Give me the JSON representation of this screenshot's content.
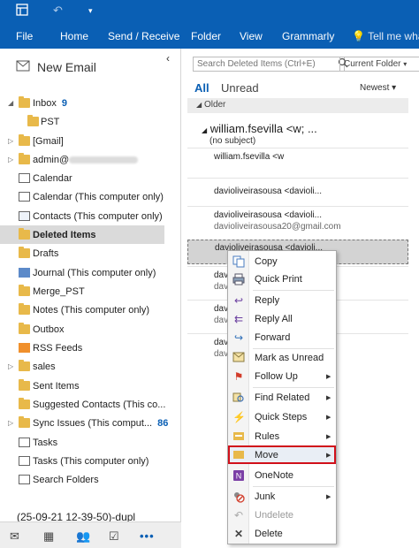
{
  "ribbon": {
    "tabs": [
      {
        "id": "file",
        "label": "File"
      },
      {
        "id": "home",
        "label": "Home"
      },
      {
        "id": "send-receive",
        "label": "Send / Receive"
      },
      {
        "id": "folder",
        "label": "Folder"
      },
      {
        "id": "view",
        "label": "View"
      },
      {
        "id": "grammarly",
        "label": "Grammarly"
      }
    ],
    "tell_me": "Tell me what"
  },
  "sidebar": {
    "new_email": "New Email",
    "folders": [
      {
        "label": "Inbox",
        "count": "9"
      },
      {
        "label": "PST"
      },
      {
        "label": "[Gmail]"
      },
      {
        "label": "admin@"
      },
      {
        "label": "Calendar"
      },
      {
        "label": "Calendar (This computer only)"
      },
      {
        "label": "Contacts (This computer only)"
      },
      {
        "label": "Deleted Items"
      },
      {
        "label": "Drafts"
      },
      {
        "label": "Journal (This computer only)"
      },
      {
        "label": "Merge_PST"
      },
      {
        "label": "Notes (This computer only)"
      },
      {
        "label": "Outbox"
      },
      {
        "label": "RSS Feeds"
      },
      {
        "label": "sales"
      },
      {
        "label": "Sent Items"
      },
      {
        "label": "Suggested Contacts (This co..."
      },
      {
        "label": "Sync Issues (This comput...",
        "count": "86"
      },
      {
        "label": "Tasks"
      },
      {
        "label": "Tasks (This computer only)"
      },
      {
        "label": "Search Folders"
      },
      {
        "label": "(25-09-21 12-39-50)-dupl"
      }
    ]
  },
  "search": {
    "placeholder": "Search Deleted Items (Ctrl+E)",
    "scope": "Current Folder"
  },
  "list": {
    "filter_all": "All",
    "filter_unread": "Unread",
    "sort": "Newest",
    "group": "Older",
    "thread_sender": "william.fsevilla <w;  ...",
    "thread_subject": "(no subject)",
    "messages": [
      {
        "from": "william.fsevilla <w",
        "sub": ""
      },
      {
        "from": "davioliveirasousa <davioli...",
        "sub": ""
      },
      {
        "from": "davioliveirasousa <davioli...",
        "sub": "davioliveirasousa20@gmail.com"
      },
      {
        "from": "davioliveirasousa <davioli...",
        "sub": ""
      },
      {
        "from": "davi",
        "sub": "davi"
      },
      {
        "from": "davi",
        "sub": "davi"
      },
      {
        "from": "davi",
        "sub": "davi"
      }
    ]
  },
  "context_menu": {
    "items": [
      {
        "label": "Copy",
        "icon": "copy-icon"
      },
      {
        "label": "Quick Print",
        "icon": "printer-icon"
      },
      {
        "label": "Reply",
        "icon": "reply-icon"
      },
      {
        "label": "Reply All",
        "icon": "reply-all-icon"
      },
      {
        "label": "Forward",
        "icon": "forward-icon"
      },
      {
        "label": "Mark as Unread",
        "icon": "envelope-icon"
      },
      {
        "label": "Follow Up",
        "icon": "flag-icon"
      },
      {
        "label": "Find Related",
        "icon": "find-related-icon"
      },
      {
        "label": "Quick Steps",
        "icon": "lightning-icon"
      },
      {
        "label": "Rules",
        "icon": "rules-icon"
      },
      {
        "label": "Move",
        "icon": "move-folder-icon"
      },
      {
        "label": "OneNote",
        "icon": "onenote-icon"
      },
      {
        "label": "Junk",
        "icon": "junk-icon"
      },
      {
        "label": "Undelete",
        "icon": "undelete-icon"
      },
      {
        "label": "Delete",
        "icon": "delete-icon"
      }
    ]
  },
  "colors": {
    "accent": "#0a5fb4",
    "highlight_border": "#d1101a"
  }
}
